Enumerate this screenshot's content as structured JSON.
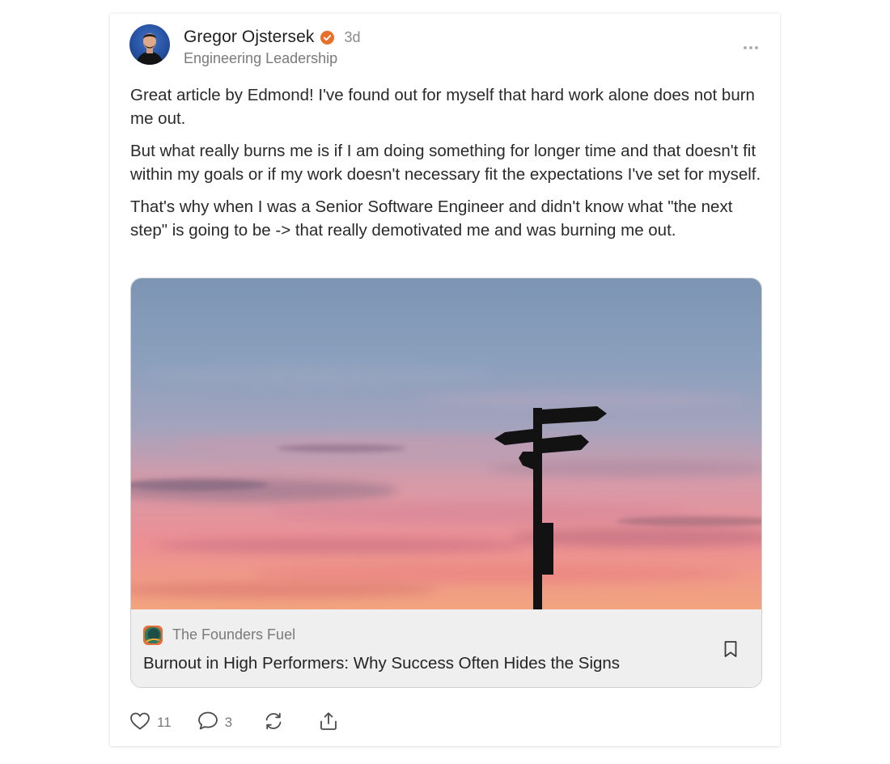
{
  "post": {
    "author_name": "Gregor Ojstersek",
    "timestamp": "3d",
    "author_subtitle": "Engineering Leadership",
    "paragraphs": [
      "Great article by Edmond! I've found out for myself that hard work alone does not burn me out.",
      "But what really burns me is if I am doing something for longer time and that doesn't fit within my goals or if my work doesn't necessary fit the expectations I've set for myself.",
      "That's why when I was a Senior Software Engineer and didn't know what \"the next step\" is going to be -> that really demotivated me and was burning me out."
    ]
  },
  "embed": {
    "publication_name": "The Founders Fuel",
    "article_title": "Burnout in High Performers: Why Success Often Hides the Signs",
    "image_alt": "Signpost silhouette against a pink sunset sky"
  },
  "actions": {
    "likes": "11",
    "comments": "3"
  },
  "icons": {
    "verified": "verified-badge-icon",
    "more": "more-options-icon",
    "bookmark": "bookmark-icon",
    "like": "heart-icon",
    "comment": "comment-bubble-icon",
    "restack": "restack-icon",
    "share": "share-icon"
  },
  "colors": {
    "verified_badge": "#e8702a",
    "text_primary": "#242424",
    "text_secondary": "#7a7a7a",
    "embed_meta_bg": "#efefef"
  }
}
